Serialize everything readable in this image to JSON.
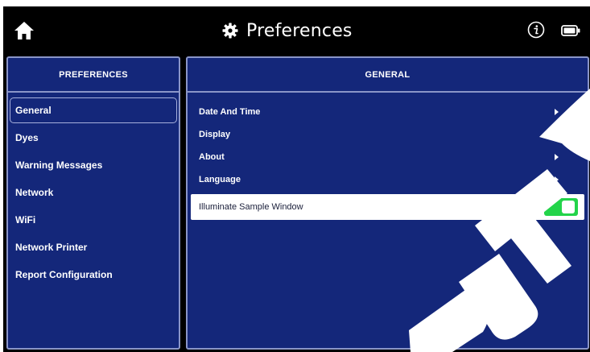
{
  "header": {
    "title": "Preferences",
    "home_icon": "home-icon",
    "title_icon": "gear-icon",
    "info_icon": "info-icon",
    "battery_icon": "battery-icon"
  },
  "left_panel": {
    "header": "PREFERENCES",
    "selected": "General",
    "items": [
      {
        "label": "General"
      },
      {
        "label": "Dyes"
      },
      {
        "label": "Warning Messages"
      },
      {
        "label": "Network"
      },
      {
        "label": "WiFi"
      },
      {
        "label": "Network Printer"
      },
      {
        "label": "Report Configuration"
      }
    ]
  },
  "right_panel": {
    "header": "GENERAL",
    "items": [
      {
        "label": "Date And Time",
        "icon": "chevron-right-icon"
      },
      {
        "label": "Display",
        "icon": "chevron-right-icon"
      },
      {
        "label": "About",
        "icon": "chevron-right-icon"
      },
      {
        "label": "Language",
        "icon": "chevron-right-icon"
      }
    ],
    "toggle": {
      "label": "Illuminate Sample Window",
      "on": true
    }
  },
  "watermark": {
    "text": "DUTS"
  },
  "colors": {
    "background": "#000000",
    "panel": "#14277a",
    "panel_border": "#8a95c8",
    "toggle_on": "#23d44a",
    "watermark": "#ffffff"
  }
}
